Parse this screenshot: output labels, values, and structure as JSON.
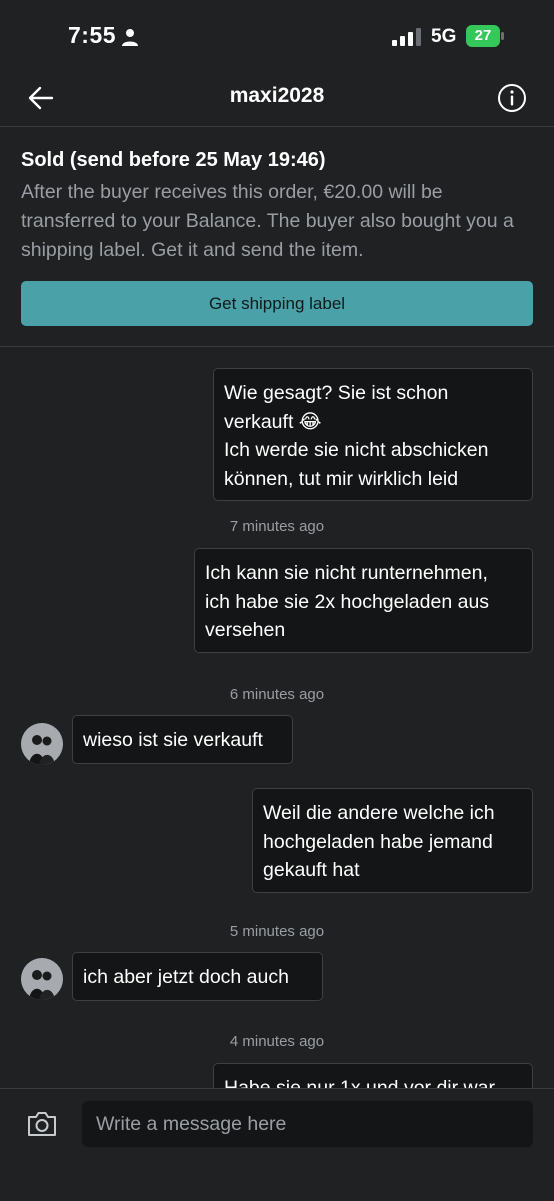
{
  "status_bar": {
    "time": "7:55",
    "network": "5G",
    "battery": "27"
  },
  "header": {
    "title": "maxi2028"
  },
  "banner": {
    "title": "Sold (send before 25 May 19:46)",
    "body": "After the buyer receives this order, €20.00 will be transferred to your Balance. The buyer also bought you a shipping label. Get it and send the item.",
    "button_label": "Get shipping label"
  },
  "messages": [
    {
      "from": "me",
      "text": "Wie gesagt? Sie ist schon\nverkauft 😂\nIch werde sie nicht abschicken\nkönnen, tut mir wirklich leid"
    },
    {
      "timestamp": "7 minutes ago"
    },
    {
      "from": "me",
      "text": "Ich kann sie nicht runternehmen,\nich habe sie 2x hochgeladen aus\nversehen"
    },
    {
      "timestamp": "6 minutes ago"
    },
    {
      "from": "them",
      "text": "wieso ist sie verkauft"
    },
    {
      "from": "me",
      "text": "Weil die andere welche ich\nhochgeladen habe jemand\ngekauft hat"
    },
    {
      "timestamp": "5 minutes ago"
    },
    {
      "from": "them",
      "text": "ich aber jetzt doch auch"
    },
    {
      "timestamp": "4 minutes ago"
    },
    {
      "from": "me",
      "text": "Habe sie nur 1x und vor dir war"
    }
  ],
  "composer": {
    "placeholder": "Write a message here"
  },
  "colors": {
    "background": "#1f2123",
    "accent": "#4aa1a7",
    "bubble": "#141516",
    "muted_text": "#9a9ea3",
    "battery_green": "#34c759"
  }
}
